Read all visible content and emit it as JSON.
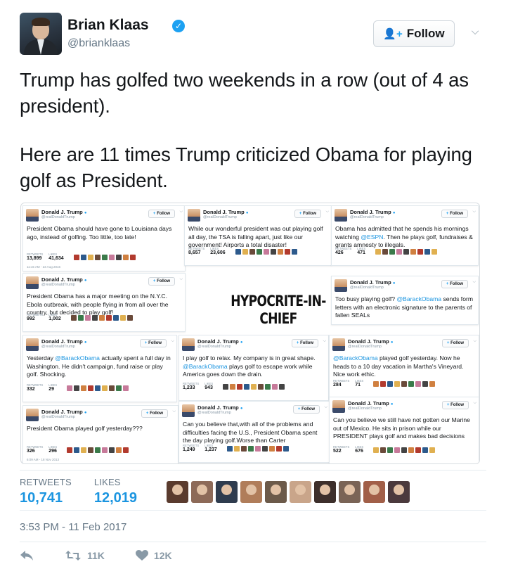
{
  "user": {
    "name": "Brian Klaas",
    "handle": "@brianklaas",
    "verified_mark": "✓"
  },
  "follow_button": {
    "icon": "👤+",
    "label": "Follow"
  },
  "menu": {
    "icon": "chevron-down-icon",
    "glyph": "⌵"
  },
  "tweet": {
    "paragraphs": [
      "Trump has golfed two weekends in a row (out of 4 as president).",
      "Here are 11 times Trump criticized Obama for playing golf as President."
    ]
  },
  "media": {
    "headline": "HYPOCRITE-IN-CHIEF",
    "card_common": {
      "name": "Donald J. Trump",
      "handle": "@realDonaldTrump",
      "follow": "Follow",
      "retweets_label": "RETWEETS",
      "likes_label": "LIKES"
    },
    "cards": [
      {
        "text": "President Obama should have gone to Louisiana days ago, instead of golfing. Too little, too late!",
        "retweets": "13,899",
        "likes": "41,634",
        "date": "11:15 AM - 23 Aug 2016"
      },
      {
        "text": "While our wonderful president was out playing golf all day, the TSA is falling apart, just like our government! Airports a total disaster!",
        "retweets": "8,657",
        "likes": "23,606",
        "date": ""
      },
      {
        "text": "Obama has admitted that he spends his mornings watching @ESPN. Then he plays golf, fundraises & grants amnesty to illegals.",
        "retweets": "426",
        "likes": "471",
        "date": ""
      },
      {
        "text": "President Obama has a major meeting on the N.Y.C. Ebola outbreak, with people flying in from all over the country, but decided to play golf!",
        "retweets": "992",
        "likes": "1,002",
        "date": ""
      },
      {
        "text": "Too busy playing golf? @BarackObama sends form letters with an electronic signature to the parents of fallen SEALs",
        "retweets": "",
        "likes": "",
        "date": ""
      },
      {
        "text": "Yesterday @BarackObama actually spent a full day in Washington. He didn't campaign, fund raise or play golf. Shocking.",
        "retweets": "332",
        "likes": "29",
        "date": ""
      },
      {
        "text": "I play golf to relax. My company is in great shape. @BarackObama plays golf to escape work while America goes down the drain.",
        "retweets": "1,233",
        "likes": "943",
        "date": ""
      },
      {
        "text": "@BarackObama played golf yesterday. Now he heads to a 10 day vacation in Martha's Vineyard. Nice work ethic.",
        "retweets": "284",
        "likes": "71",
        "date": ""
      },
      {
        "text": "President Obama played golf yesterday???",
        "retweets": "326",
        "likes": "296",
        "date": "6:09 AM - 18 Nov 2013"
      },
      {
        "text": "Can you believe that,with all of the problems and difficulties facing the U.S., President Obama spent the day playing golf.Worse than Carter",
        "retweets": "1,249",
        "likes": "1,237",
        "date": ""
      },
      {
        "text": "Can you believe we still have not gotten our Marine out of Mexico. He sits in prison while our PRESIDENT plays golf and makes bad decisions",
        "retweets": "522",
        "likes": "676",
        "date": ""
      }
    ]
  },
  "engagement": {
    "retweets_label": "RETWEETS",
    "retweets": "10,741",
    "likes_label": "LIKES",
    "likes": "12,019",
    "liker_colors": [
      "#5a3b2e",
      "#8d6a58",
      "#2f3c4e",
      "#b07d5a",
      "#6c5a4a",
      "#c9a58a",
      "#3d2f2b",
      "#7a6456",
      "#a15f48",
      "#4b3a3d"
    ]
  },
  "timestamp": "3:53 PM - 11 Feb 2017",
  "actions": {
    "reply_icon": "reply-icon",
    "retweet_icon": "retweet-icon",
    "retweet_count": "11K",
    "like_icon": "heart-icon",
    "like_count": "12K"
  },
  "colors": {
    "accent": "#1b95e0",
    "verified": "#1da1f2",
    "muted": "#657786"
  }
}
